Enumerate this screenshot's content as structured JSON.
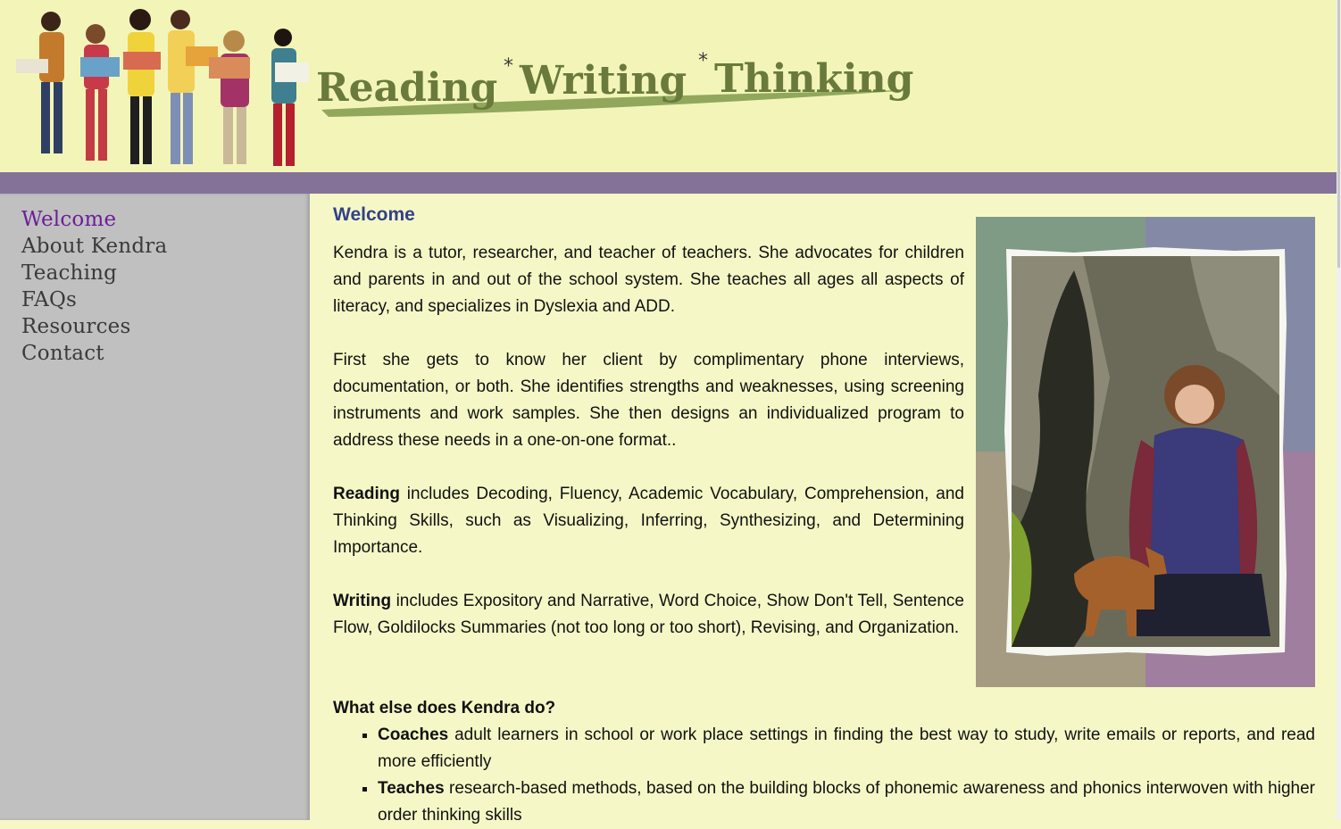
{
  "header": {
    "logo_words": [
      "Reading",
      "Writing",
      "Thinking"
    ],
    "logo_separator": "*"
  },
  "nav": {
    "items": [
      {
        "label": "Welcome",
        "active": true
      },
      {
        "label": "About Kendra",
        "active": false
      },
      {
        "label": "Teaching",
        "active": false
      },
      {
        "label": "FAQs",
        "active": false
      },
      {
        "label": "Resources",
        "active": false
      },
      {
        "label": "Contact",
        "active": false
      }
    ]
  },
  "main": {
    "title": "Welcome",
    "intro": "Kendra is a tutor, researcher, and teacher of teachers. She advocates for children and parents in and out of the school system. She teaches all ages all aspects of literacy, and specializes in Dyslexia and ADD.",
    "approach": "First she gets to know her client by complimentary phone interviews, documentation, or both. She identifies strengths and weaknesses, using screening instruments and work samples. She then designs an individualized program to address these needs in a one-on-one format..",
    "reading_label": "Reading",
    "reading_text": " includes Decoding, Fluency, Academic Vocabulary, Comprehension, and Thinking Skills, such as Visualizing, Inferring, Synthesizing, and Determining Importance.",
    "writing_label": "Writing",
    "writing_text": " includes Expository and Narrative, Word Choice, Show Don't Tell, Sentence Flow, Goldilocks Summaries (not too long or too short), Revising, and Organization.",
    "more_heading": "What else does Kendra do?",
    "more_items": [
      {
        "label": "Coaches",
        "text": " adult learners in school or work place settings in finding the best way to study, write emails or reports, and read more efficiently"
      },
      {
        "label": "Teaches",
        "text": " research-based methods, based on the building blocks of phonemic awareness and phonics interwoven with higher order thinking skills"
      }
    ]
  },
  "colors": {
    "header_bg": "#f3f5b8",
    "band": "#857298",
    "sidebar_bg": "#c0c0c0",
    "content_bg": "#f5f8c6",
    "nav_active": "#6c1e9a",
    "title": "#33408a",
    "logo_green": "#697a3c"
  }
}
